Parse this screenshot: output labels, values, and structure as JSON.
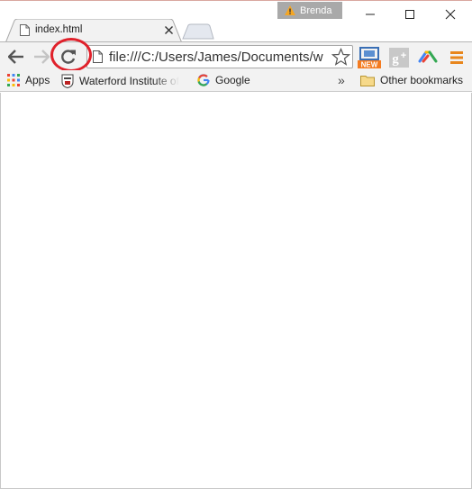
{
  "window": {
    "profile_name": "Brenda",
    "controls": [
      "minimize-icon",
      "maximize-icon",
      "close-icon"
    ]
  },
  "tabs": [
    {
      "title": "index.html",
      "icon": "file-icon",
      "active": true
    }
  ],
  "toolbar": {
    "back_icon": "back-arrow-icon",
    "forward_icon": "forward-arrow-icon",
    "reload_icon": "reload-icon",
    "url": "file:///C:/Users/James/Documents/w",
    "bookmark_star_icon": "star-icon",
    "extensions": [
      "new-ext-icon",
      "google-plus-icon",
      "drive-icon",
      "menu-icon"
    ]
  },
  "bookmarks": {
    "items": [
      {
        "label": "Apps",
        "icon": "apps-grid-icon"
      },
      {
        "label": "Waterford Institute of",
        "icon": "wit-crest-icon"
      },
      {
        "label": "Google",
        "icon": "google-g-icon"
      }
    ],
    "overflow_icon": "chevron-double-right-icon",
    "other_label": "Other bookmarks"
  },
  "colors": {
    "highlight_ring": "#e0212b",
    "toolbar_bg": "#f2f2f2",
    "profile_bg": "#a9a9a9"
  }
}
